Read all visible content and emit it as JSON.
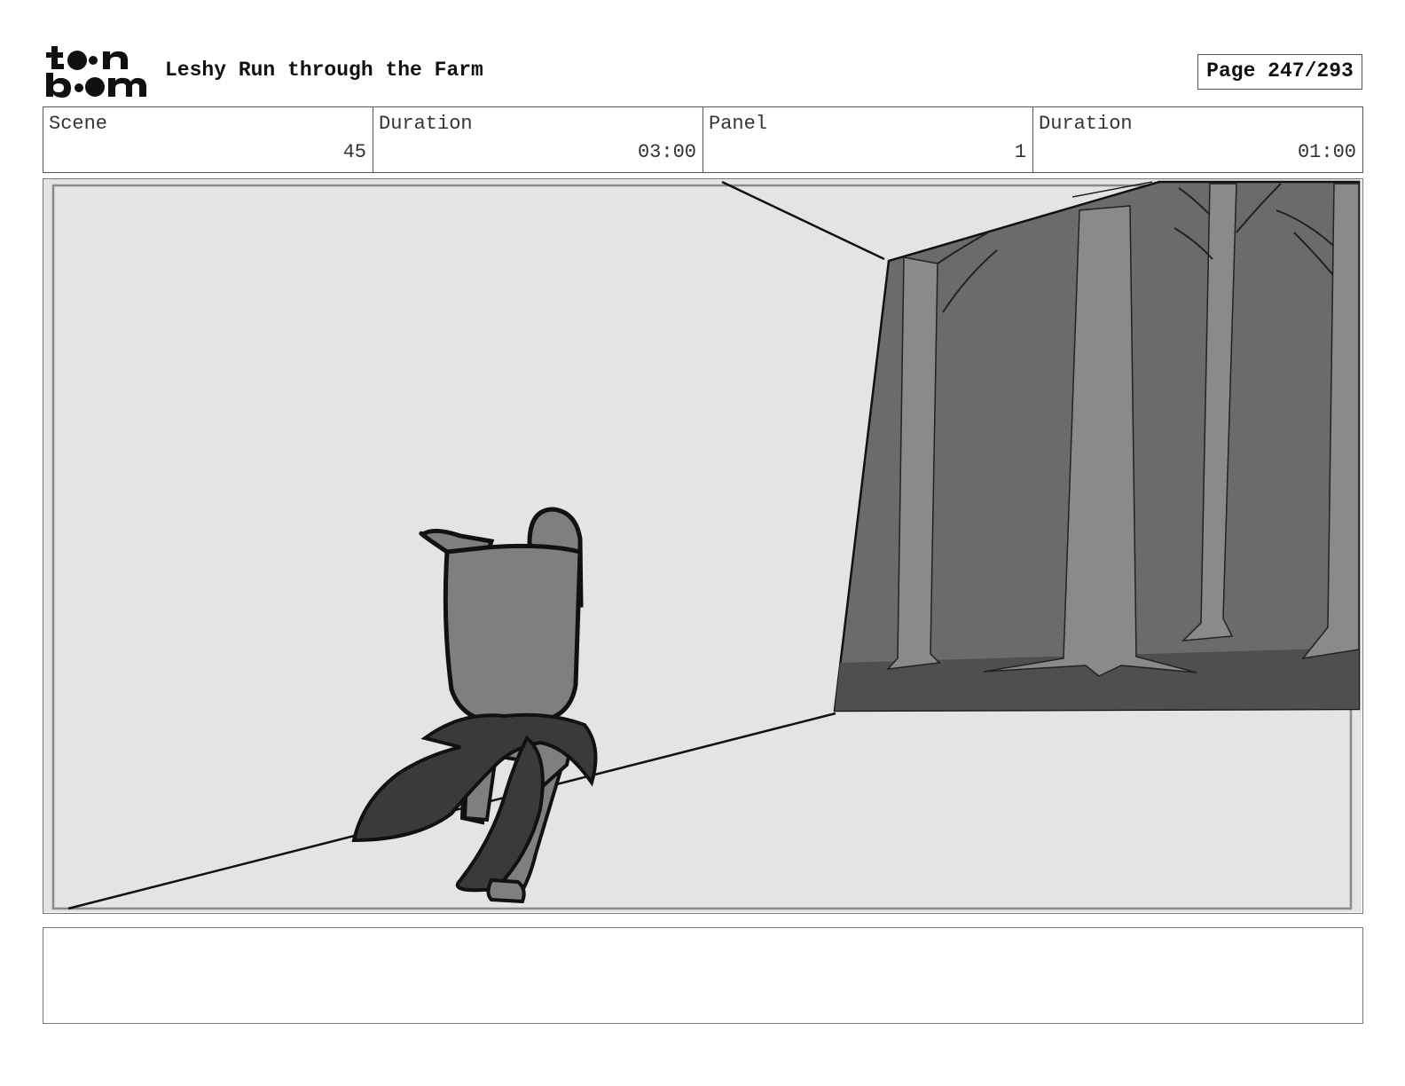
{
  "header": {
    "logo": "toon boom logo",
    "title": "Leshy Run through the Farm",
    "page": "Page 247/293"
  },
  "info": {
    "scene_label": "Scene",
    "scene_value": "45",
    "duration_label": "Duration",
    "duration_value": "03:00",
    "panel_label": "Panel",
    "panel_value": "1",
    "panel_duration_label": "Duration",
    "panel_duration_value": "01:00"
  },
  "colors": {
    "panel_bg": "#e4e4e4",
    "forest_wall": "#6b6b6b",
    "tree": "#8a8a8a",
    "ground": "#4f4f4f",
    "character_body": "#7f7f7f",
    "character_cape": "#3a3a3a"
  },
  "notes": {
    "text": ""
  }
}
